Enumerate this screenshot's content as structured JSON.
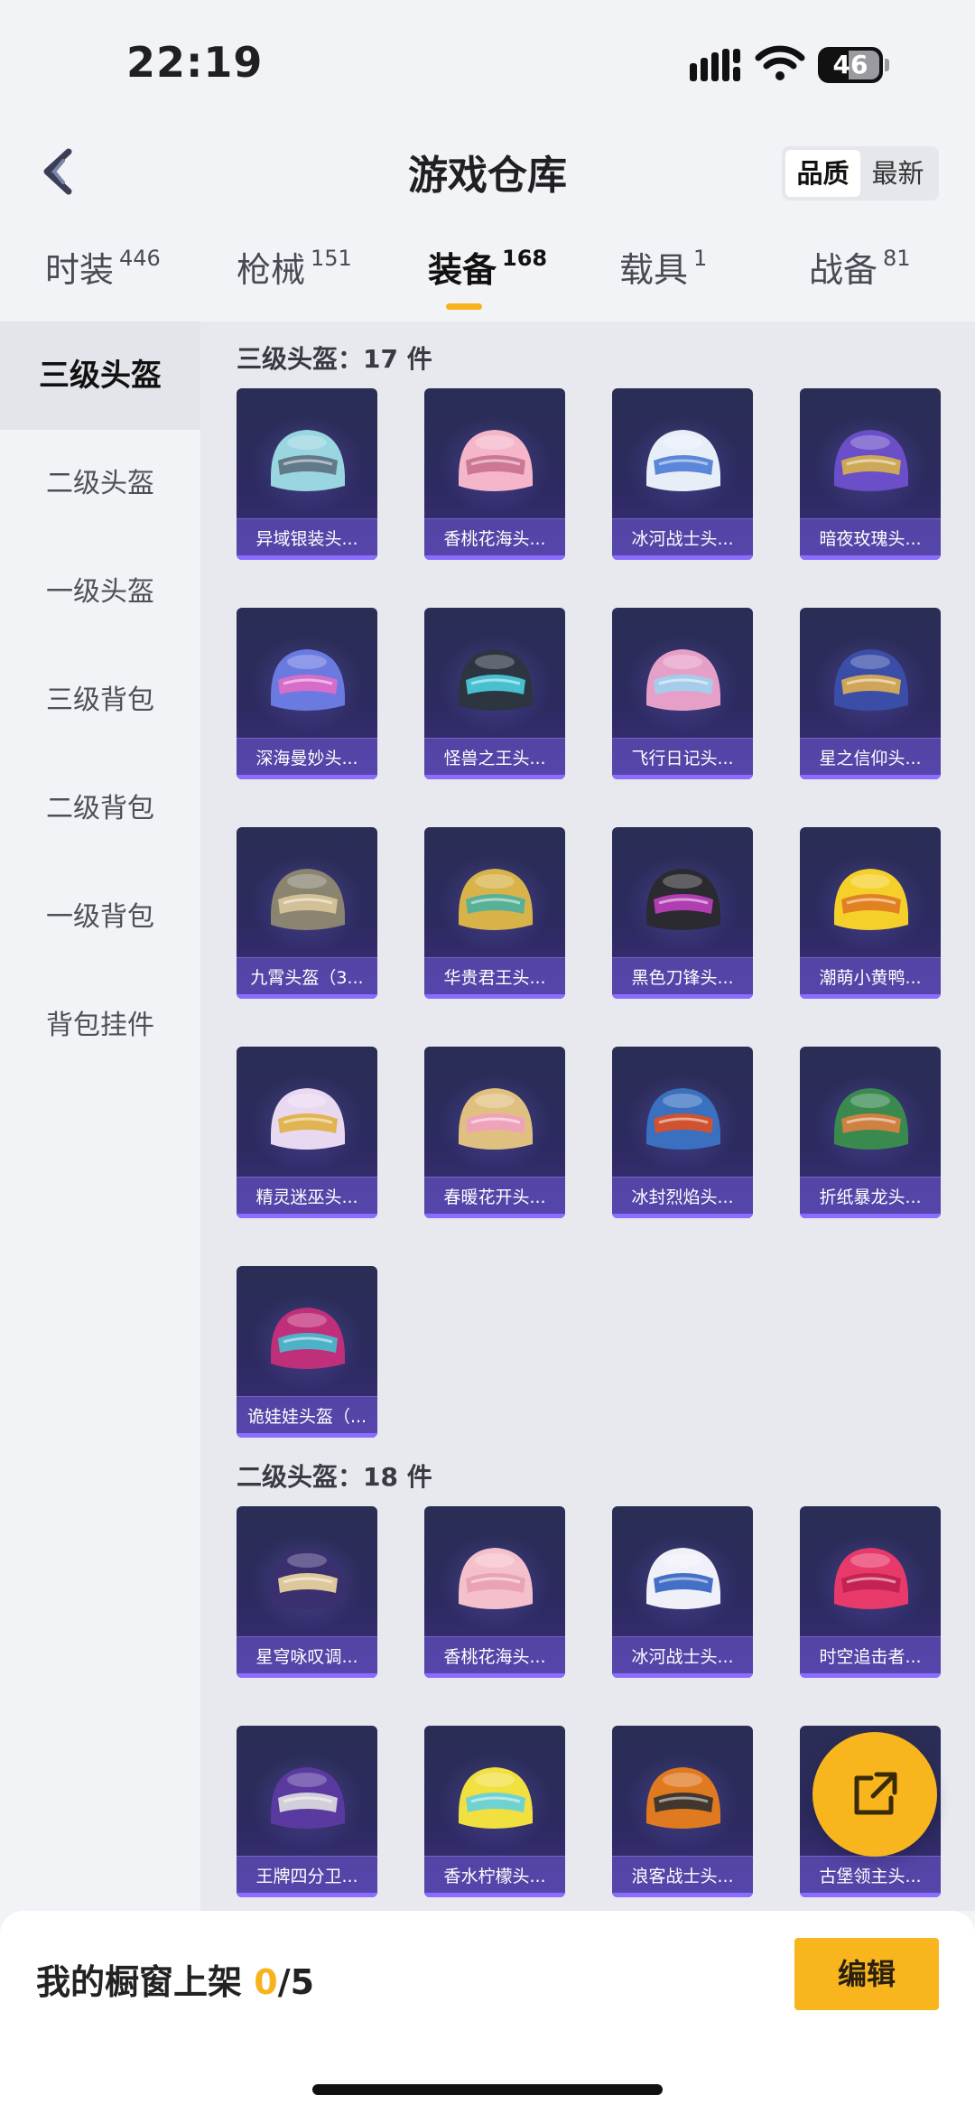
{
  "status": {
    "time": "22:19",
    "battery": "46"
  },
  "header": {
    "title": "游戏仓库",
    "sort": [
      "品质",
      "最新"
    ]
  },
  "tabs": [
    {
      "label": "时装",
      "count": "446"
    },
    {
      "label": "枪械",
      "count": "151"
    },
    {
      "label": "装备",
      "count": "168"
    },
    {
      "label": "载具",
      "count": "1"
    },
    {
      "label": "战备",
      "count": "81"
    }
  ],
  "sidebar": [
    "三级头盔",
    "二级头盔",
    "一级头盔",
    "三级背包",
    "二级背包",
    "一级背包",
    "背包挂件"
  ],
  "sections": [
    {
      "title": "三级头盔：17 件",
      "items": [
        {
          "name": "异域银装头...",
          "icon": "helmet-icon"
        },
        {
          "name": "香桃花海头...",
          "icon": "helmet-icon"
        },
        {
          "name": "冰河战士头...",
          "icon": "helmet-icon"
        },
        {
          "name": "暗夜玫瑰头...",
          "icon": "helmet-icon"
        },
        {
          "name": "深海曼妙头...",
          "icon": "helmet-icon"
        },
        {
          "name": "怪兽之王头...",
          "icon": "helmet-icon"
        },
        {
          "name": "飞行日记头...",
          "icon": "helmet-icon"
        },
        {
          "name": "星之信仰头...",
          "icon": "helmet-icon"
        },
        {
          "name": "九霄头盔（3...",
          "icon": "helmet-icon"
        },
        {
          "name": "华贵君王头...",
          "icon": "helmet-icon"
        },
        {
          "name": "黑色刀锋头...",
          "icon": "helmet-icon"
        },
        {
          "name": "潮萌小黄鸭...",
          "icon": "helmet-icon"
        },
        {
          "name": "精灵迷巫头...",
          "icon": "helmet-icon"
        },
        {
          "name": "春暖花开头...",
          "icon": "helmet-icon"
        },
        {
          "name": "冰封烈焰头...",
          "icon": "helmet-icon"
        },
        {
          "name": "折纸暴龙头...",
          "icon": "helmet-icon"
        },
        {
          "name": "诡娃娃头盔（...",
          "icon": "helmet-icon"
        }
      ]
    },
    {
      "title": "二级头盔：18 件",
      "items": [
        {
          "name": "星穹咏叹调...",
          "icon": "helmet-icon"
        },
        {
          "name": "香桃花海头...",
          "icon": "helmet-icon"
        },
        {
          "name": "冰河战士头...",
          "icon": "helmet-icon"
        },
        {
          "name": "时空追击者...",
          "icon": "helmet-icon"
        },
        {
          "name": "王牌四分卫...",
          "icon": "helmet-icon"
        },
        {
          "name": "香水柠檬头...",
          "icon": "helmet-icon"
        },
        {
          "name": "浪客战士头...",
          "icon": "helmet-icon"
        },
        {
          "name": "古堡领主头...",
          "icon": "helmet-icon"
        }
      ]
    }
  ],
  "colors": {
    "accent": "#f7b21c",
    "card": "#2c2a5f"
  },
  "bottom": {
    "label": "我的橱窗上架 ",
    "count": "0",
    "total": "/5",
    "edit": "编辑"
  }
}
